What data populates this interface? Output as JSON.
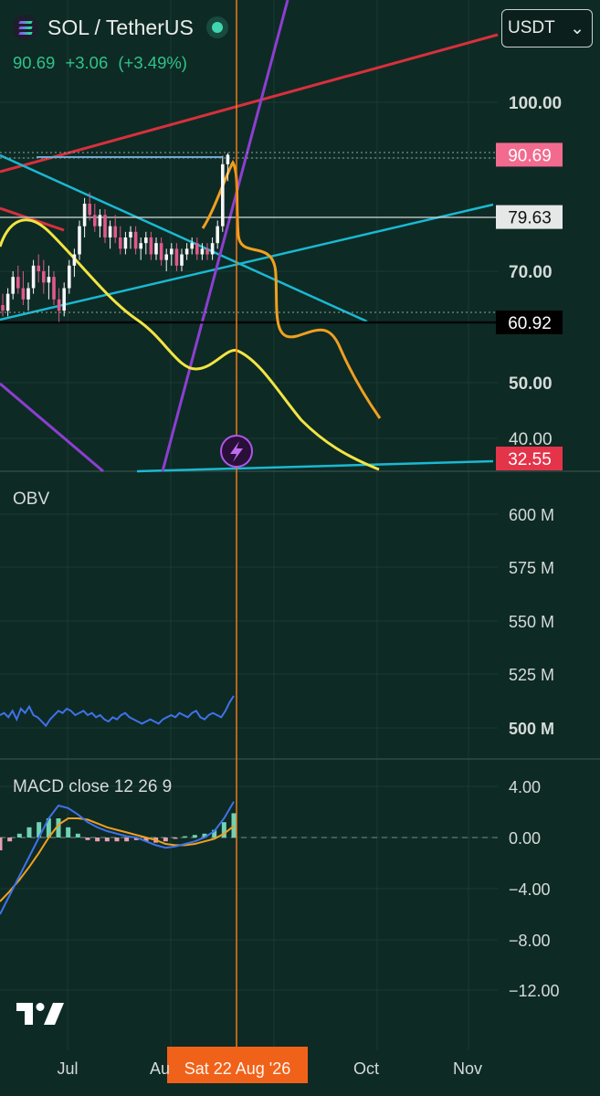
{
  "header": {
    "symbol": "SOL / TetherUS",
    "last_price": "90.69",
    "change": "+3.06",
    "change_pct": "(+3.49%)",
    "currency_button": "USDT",
    "currency_chevron": "⌄"
  },
  "colors": {
    "background": "#0e2a25",
    "up": "#2fc389",
    "trendline_cyan": "#1ab9d2",
    "trendline_red": "#d8303c",
    "trendline_purple": "#8c3fd0",
    "drawing_yellow": "#f2e543",
    "drawing_orange": "#f0a020",
    "obv_line": "#3f72e8",
    "cursor": "#f07a16"
  },
  "chart_data": [
    {
      "type": "candlestick",
      "title": "SOL / TetherUS",
      "y_ticks": [
        "100.00",
        "70.00",
        "50.00",
        "40.00"
      ],
      "price_labels": [
        {
          "text": "90.69",
          "value": 90.69,
          "kind": "last-price"
        },
        {
          "text": "79.63",
          "value": 79.63,
          "kind": "horizontal-line"
        },
        {
          "text": "60.92",
          "value": 60.92,
          "kind": "horizontal-line"
        },
        {
          "text": "32.55",
          "value": 32.55,
          "kind": "cursor-price"
        }
      ],
      "x_ticks": [
        "Jul",
        "Au",
        "Oct",
        "Nov"
      ],
      "cursor_label": "Sat 22 Aug '26",
      "ohlc_approx": [
        [
          64,
          66,
          62,
          63
        ],
        [
          63,
          67,
          62,
          66
        ],
        [
          66,
          70,
          65,
          69
        ],
        [
          69,
          71,
          66,
          67
        ],
        [
          67,
          70,
          64,
          65
        ],
        [
          65,
          68,
          63,
          67
        ],
        [
          67,
          72,
          66,
          71
        ],
        [
          71,
          73,
          68,
          70
        ],
        [
          70,
          72,
          66,
          68
        ],
        [
          68,
          71,
          65,
          69
        ],
        [
          69,
          70,
          64,
          65
        ],
        [
          65,
          67,
          61,
          63
        ],
        [
          63,
          68,
          62,
          67
        ],
        [
          67,
          72,
          66,
          71
        ],
        [
          71,
          74,
          69,
          73
        ],
        [
          73,
          79,
          72,
          78
        ],
        [
          78,
          83,
          76,
          82
        ],
        [
          82,
          84,
          79,
          80
        ],
        [
          80,
          82,
          77,
          78
        ],
        [
          78,
          81,
          76,
          80
        ],
        [
          80,
          81,
          75,
          76
        ],
        [
          76,
          79,
          74,
          78
        ],
        [
          78,
          80,
          75,
          76
        ],
        [
          76,
          78,
          73,
          74
        ],
        [
          74,
          77,
          73,
          76
        ],
        [
          76,
          78,
          74,
          77
        ],
        [
          77,
          78,
          73,
          74
        ],
        [
          74,
          76,
          72,
          75
        ],
        [
          75,
          77,
          73,
          76
        ],
        [
          76,
          77,
          72,
          73
        ],
        [
          73,
          76,
          72,
          75
        ],
        [
          75,
          76,
          71,
          72
        ],
        [
          72,
          74,
          70,
          73
        ],
        [
          73,
          75,
          71,
          74
        ],
        [
          74,
          75,
          70,
          71
        ],
        [
          71,
          74,
          70,
          73
        ],
        [
          73,
          75,
          72,
          74
        ],
        [
          74,
          76,
          73,
          75
        ],
        [
          75,
          76,
          72,
          73
        ],
        [
          73,
          75,
          72,
          74
        ],
        [
          74,
          75,
          72,
          73
        ],
        [
          73,
          76,
          72,
          75
        ],
        [
          75,
          79,
          74,
          78
        ],
        [
          78,
          90.5,
          77,
          89
        ],
        [
          89,
          91,
          86,
          90.69
        ]
      ]
    },
    {
      "type": "line",
      "title": "OBV",
      "y_ticks": [
        "600 M",
        "575 M",
        "550 M",
        "525 M",
        "500 M"
      ],
      "ylim": [
        495,
        615
      ],
      "series": [
        {
          "name": "OBV",
          "values": [
            506,
            507,
            505,
            508,
            504,
            509,
            507,
            510,
            506,
            505,
            503,
            501,
            504,
            506,
            508,
            507,
            509,
            508,
            506,
            507,
            508,
            506,
            507,
            505,
            506,
            504,
            503,
            505,
            504,
            506,
            507,
            505,
            504,
            503,
            502,
            503,
            504,
            503,
            502,
            504,
            505,
            506,
            505,
            507,
            506,
            505,
            507,
            508,
            505,
            504,
            506,
            507,
            506,
            505,
            508,
            512,
            515
          ]
        }
      ]
    },
    {
      "type": "line",
      "title": "MACD close 12 26 9",
      "y_ticks": [
        "4.00",
        "0.00",
        "−4.00",
        "−8.00",
        "−12.00"
      ],
      "ylim": [
        -14,
        5
      ],
      "series": [
        {
          "name": "MACD",
          "values": [
            -6.0,
            -4.5,
            -3.0,
            -1.5,
            0.0,
            1.5,
            2.5,
            2.3,
            1.8,
            1.2,
            0.8,
            0.5,
            0.3,
            0.1,
            0.0,
            -0.3,
            -0.6,
            -0.8,
            -0.7,
            -0.5,
            -0.3,
            0.0,
            0.5,
            1.5,
            2.8
          ]
        },
        {
          "name": "Signal",
          "values": [
            -5.0,
            -4.2,
            -3.3,
            -2.3,
            -1.2,
            0.0,
            1.0,
            1.5,
            1.5,
            1.4,
            1.1,
            0.8,
            0.6,
            0.4,
            0.2,
            0.0,
            -0.2,
            -0.5,
            -0.6,
            -0.6,
            -0.5,
            -0.3,
            -0.1,
            0.3,
            0.9
          ]
        },
        {
          "name": "Histogram",
          "values": [
            -1.0,
            -0.3,
            0.3,
            0.8,
            1.2,
            1.5,
            1.5,
            0.8,
            0.3,
            -0.2,
            -0.3,
            -0.3,
            -0.3,
            -0.3,
            -0.2,
            -0.3,
            -0.4,
            -0.3,
            -0.1,
            0.1,
            0.2,
            0.3,
            0.6,
            1.2,
            1.9
          ]
        }
      ]
    }
  ]
}
